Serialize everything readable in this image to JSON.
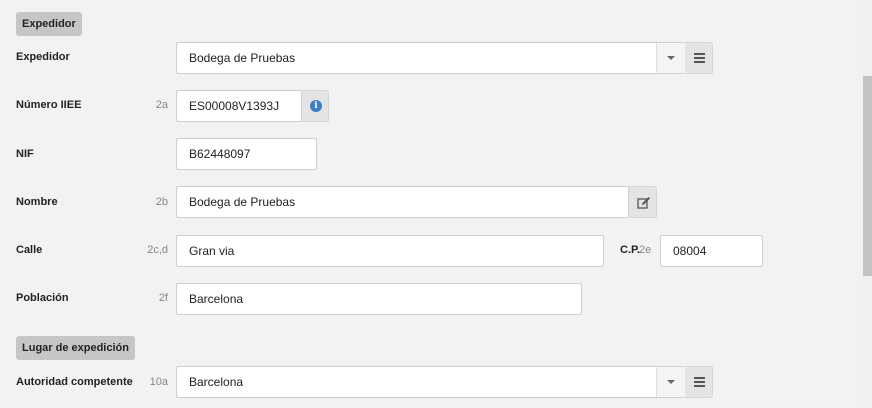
{
  "sections": {
    "expedidor_tag": "Expedidor",
    "lugar_tag": "Lugar de expedición"
  },
  "fields": {
    "expedidor": {
      "label": "Expedidor",
      "code": "",
      "value": "Bodega de Pruebas"
    },
    "numero_iiee": {
      "label": "Número IIEE",
      "code": "2a",
      "value": "ES00008V1393J"
    },
    "nif": {
      "label": "NIF",
      "code": "",
      "value": "B62448097"
    },
    "nombre": {
      "label": "Nombre",
      "code": "2b",
      "value": "Bodega de Pruebas"
    },
    "calle": {
      "label": "Calle",
      "code": "2c,d",
      "value": "Gran via"
    },
    "cp": {
      "label": "C.P.",
      "code": "2e",
      "value": "08004"
    },
    "poblacion": {
      "label": "Población",
      "code": "2f",
      "value": "Barcelona"
    },
    "autoridad": {
      "label": "Autoridad competente",
      "code": "10a",
      "value": "Barcelona"
    }
  },
  "icons": {
    "info": "info-icon",
    "edit": "edit-icon",
    "menu": "menu-icon",
    "dropdown": "chevron-down-icon"
  },
  "colors": {
    "info_blue": "#3d7fc7",
    "section_tag_bg": "#c6c6c6",
    "page_bg": "#f2f2f2"
  }
}
